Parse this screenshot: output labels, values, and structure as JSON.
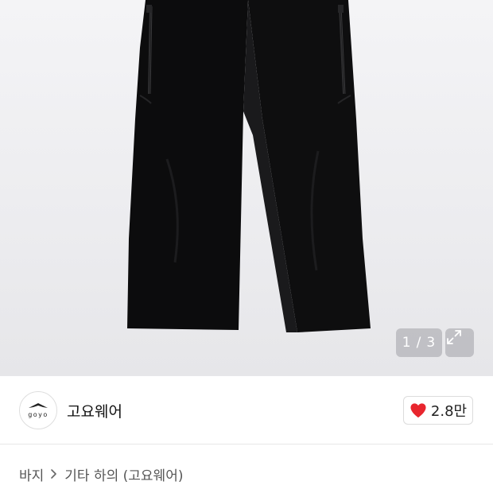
{
  "gallery": {
    "current_page": "1",
    "separator": "/",
    "total_pages": "3",
    "expand_icon": "expand-icon"
  },
  "brand": {
    "logo_text": "goyo",
    "name": "고요웨어"
  },
  "like": {
    "icon": "heart-icon",
    "count": "2.8만",
    "color": "#e8262e"
  },
  "breadcrumb": {
    "category": "바지",
    "subcategory": "기타 하의 (고요웨어)"
  }
}
